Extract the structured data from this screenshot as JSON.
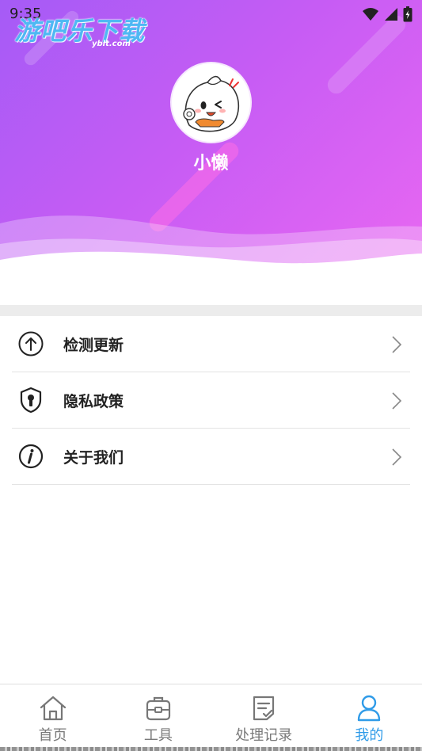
{
  "status": {
    "time": "9:35"
  },
  "watermark": {
    "text": "游吧乐下载",
    "sub": "yblt.com"
  },
  "profile": {
    "username": "小懒"
  },
  "menu": {
    "items": [
      {
        "label": "检测更新",
        "icon": "upload-circle-icon"
      },
      {
        "label": "隐私政策",
        "icon": "shield-lock-icon"
      },
      {
        "label": "关于我们",
        "icon": "info-circle-icon"
      }
    ]
  },
  "bottom_nav": {
    "items": [
      {
        "label": "首页",
        "icon": "home-icon"
      },
      {
        "label": "工具",
        "icon": "toolbox-icon"
      },
      {
        "label": "处理记录",
        "icon": "records-icon"
      },
      {
        "label": "我的",
        "icon": "user-icon",
        "active": true
      }
    ]
  },
  "colors": {
    "gradient_start": "#a55bf6",
    "gradient_end": "#ea68f2",
    "active": "#2f9be8"
  }
}
